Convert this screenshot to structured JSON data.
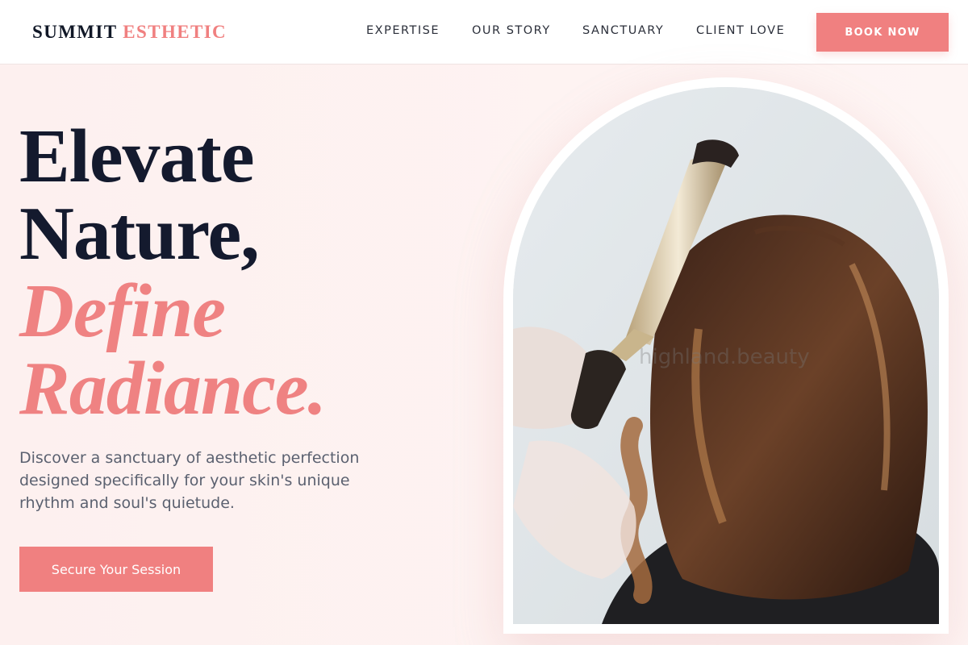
{
  "header": {
    "logo_part1": "SUMMIT",
    "logo_part2": "ESTHETIC",
    "nav": [
      "EXPERTISE",
      "OUR STORY",
      "SANCTUARY",
      "CLIENT LOVE"
    ],
    "cta": "BOOK NOW"
  },
  "hero": {
    "headline": [
      "Elevate",
      "Nature,",
      "Define",
      "Radiance."
    ],
    "subtitle": "Discover a sanctuary of aesthetic perfection designed specifically for your skin's unique rhythm and soul's quietude.",
    "cta": "Secure Your Session",
    "watermark": "highland.beauty"
  },
  "colors": {
    "accent": "#f08080",
    "dark": "#141a2e",
    "background": "#fdf1f0",
    "text_muted": "#5b6170"
  },
  "icons": {
    "hero_image": "woman-hair-curling-photo"
  }
}
